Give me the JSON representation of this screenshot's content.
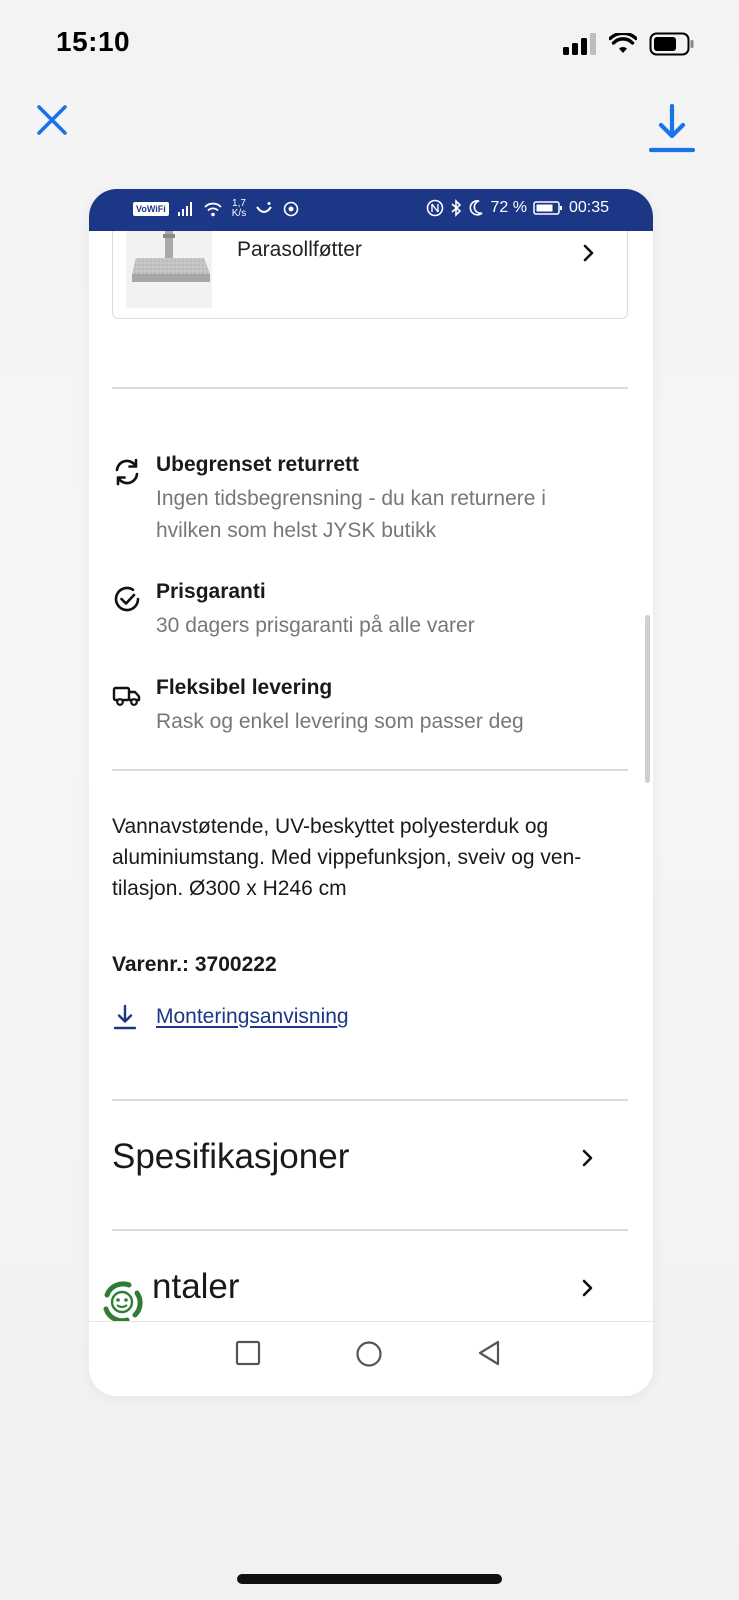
{
  "ios_status": {
    "time": "15:10"
  },
  "toolbar": {
    "close_icon": "close-icon",
    "download_icon": "download-icon",
    "accent_color": "#1a73e8"
  },
  "android_status": {
    "vowifi": "VoWiFi",
    "net_speed_value": "1,7",
    "net_speed_unit": "K/s",
    "battery": "72 %",
    "time": "00:35",
    "bar_color": "#1d3787"
  },
  "product_card": {
    "label": "Parasollføtter"
  },
  "usps": [
    {
      "icon": "refresh-icon",
      "title": "Ubegrenset returrett",
      "desc": "Ingen tidsbegrensning - du kan returnere i hvilken som helst JYSK butikk"
    },
    {
      "icon": "check-circle-icon",
      "title": "Prisgaranti",
      "desc": "30 dagers prisgaranti på alle varer"
    },
    {
      "icon": "truck-icon",
      "title": "Fleksibel levering",
      "desc": "Rask og enkel levering som passer deg"
    }
  ],
  "description": "Vannavstøtende, UV-beskyttet polyesterduk og aluminiumstang. Med vippefunksjon, sveiv og ven-tilasjon. Ø300 x H246 cm",
  "item_number": "Varenr.: 3700222",
  "manual_link": "Monteringsanvisning",
  "sections": [
    {
      "title": "Spesifikasjoner"
    },
    {
      "title": "ntaler"
    }
  ]
}
